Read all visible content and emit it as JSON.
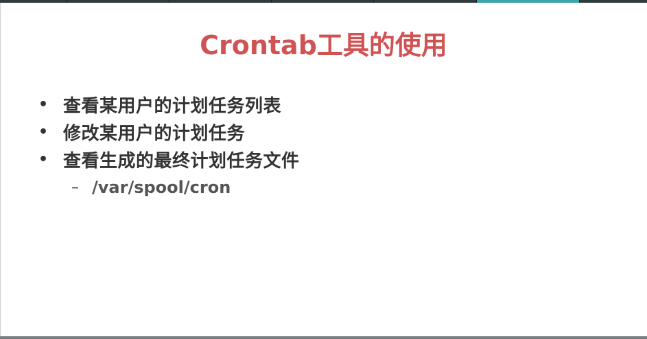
{
  "colors": {
    "title": "#d05353",
    "bullet_text": "#333333",
    "sub_text": "#555555",
    "top_bar_dark": "#2f3a3d",
    "top_bar_active": "#3aa6a8"
  },
  "slide": {
    "title": "Crontab工具的使用",
    "bullets": [
      {
        "marker": "•",
        "text": "查看某用户的计划任务列表"
      },
      {
        "marker": "•",
        "text": "修改某用户的计划任务"
      },
      {
        "marker": "•",
        "text": "查看生成的最终计划任务文件"
      }
    ],
    "sub_item": {
      "marker": "–",
      "text": "/var/spool/cron"
    }
  }
}
